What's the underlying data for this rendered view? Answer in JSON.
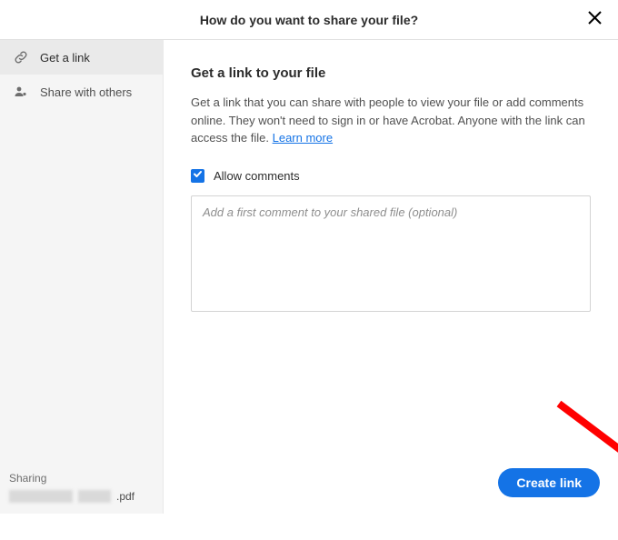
{
  "header": {
    "title": "How do you want to share your file?"
  },
  "sidebar": {
    "items": [
      {
        "label": "Get a link"
      },
      {
        "label": "Share with others"
      }
    ],
    "footer": {
      "sharing_label": "Sharing",
      "file_ext": ".pdf"
    }
  },
  "main": {
    "section_title": "Get a link to your file",
    "description": "Get a link that you can share with people to view your file or add comments online. They won't need to sign in or have Acrobat. Anyone with the link can access the file. ",
    "learn_more": "Learn more",
    "allow_comments_label": "Allow comments",
    "allow_comments_checked": true,
    "comment_placeholder": "Add a first comment to your shared file (optional)",
    "create_button": "Create link"
  }
}
